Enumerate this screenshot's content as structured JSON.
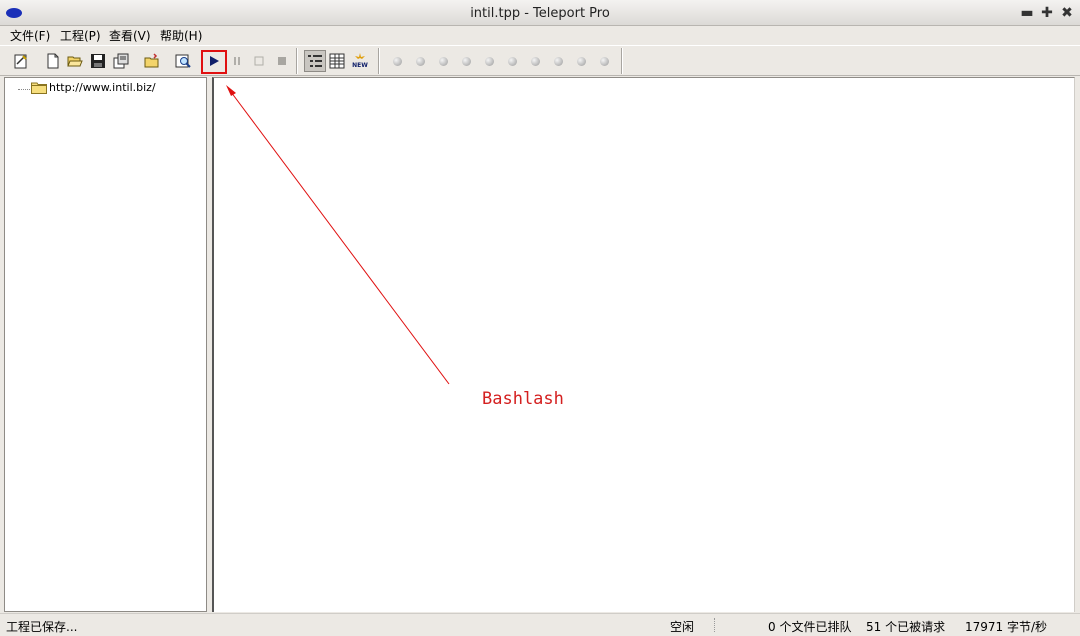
{
  "window": {
    "title": "intil.tpp - Teleport Pro",
    "controls": {
      "minimize": "▬",
      "maximize": "✚",
      "close": "✖"
    }
  },
  "menu": {
    "file": "文件(F)",
    "project": "工程(P)",
    "view": "查看(V)",
    "help": "帮助(H)"
  },
  "toolbar": {
    "buttons": [
      "project-properties-icon",
      "new-project-icon",
      "open-project-icon",
      "save-project-icon",
      "project-wizard-icon",
      "open-folder-icon",
      "browse-files-icon",
      "start-icon",
      "pause-icon",
      "stop-icon",
      "stop-all-icon",
      "view-tree-icon",
      "view-list-icon",
      "new-files-icon"
    ],
    "thread_indicators": 10,
    "highlighted": "start-icon"
  },
  "tree": {
    "items": [
      {
        "label": "http://www.intil.biz/",
        "icon": "folder-icon"
      }
    ]
  },
  "annotation": {
    "text": "Bashlash",
    "color": "#d42020"
  },
  "status": {
    "message": "工程已保存...",
    "state": "空闲",
    "queued": "0 个文件已排队",
    "requested": "51 个已被请求",
    "rate": "17971 字节/秒"
  },
  "colors": {
    "chrome": "#ece9e4",
    "pane": "#ffffff",
    "highlight": "#e01010",
    "app_icon": "#1a2fb8"
  }
}
